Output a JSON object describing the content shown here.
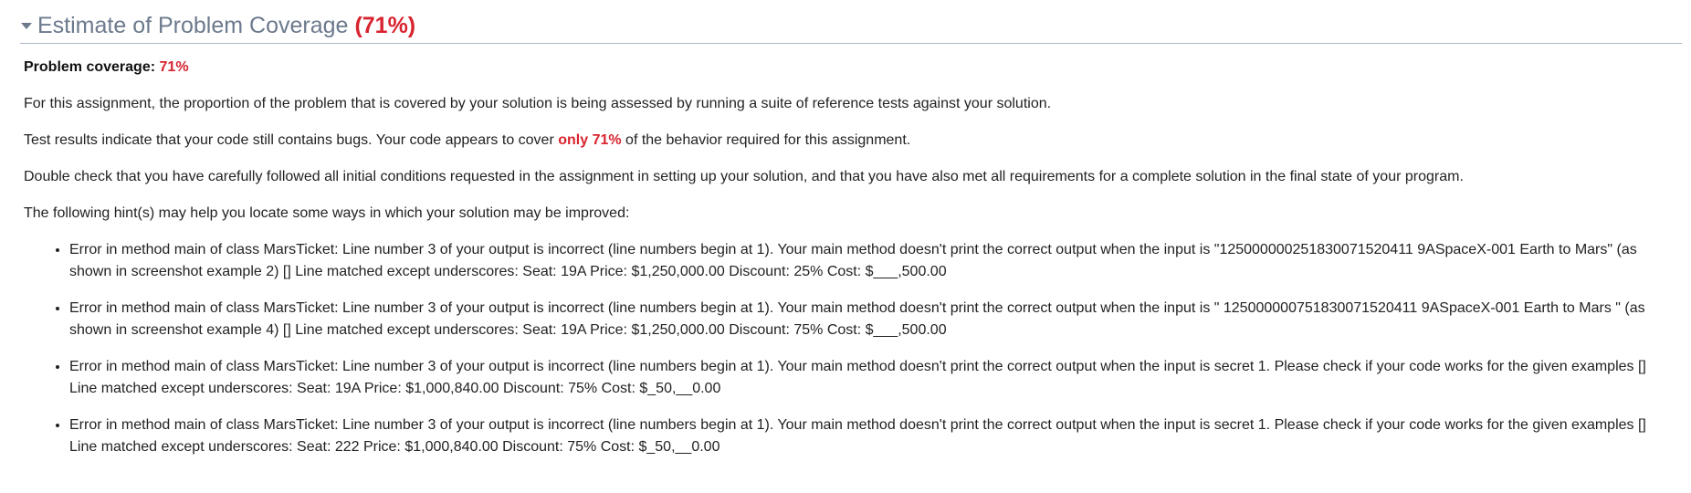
{
  "header": {
    "title": "Estimate of Problem Coverage",
    "percent": "(71%)",
    "caret_icon": "caret-down-icon"
  },
  "coverage": {
    "label": "Problem coverage:",
    "value": "71%"
  },
  "paragraphs": {
    "intro": "For this assignment, the proportion of the problem that is covered by your solution is being assessed by running a suite of reference tests against your solution.",
    "results_pre": "Test results indicate that your code still contains bugs. Your code appears to cover ",
    "results_highlight": "only 71%",
    "results_post": " of the behavior required for this assignment.",
    "double_check": "Double check that you have carefully followed all initial conditions requested in the assignment in setting up your solution, and that you have also met all requirements for a complete solution in the final state of your program.",
    "hints_intro": "The following hint(s) may help you locate some ways in which your solution may be improved:"
  },
  "hints": [
    "Error in method main of class MarsTicket: Line number 3 of your output is incorrect (line numbers begin at 1). Your main method doesn't print the correct output when the input is \"125000000251830071520411 9ASpaceX-001 Earth to Mars\" (as shown in screenshot example 2) [] Line matched except underscores: Seat: 19A Price: $1,250,000.00 Discount: 25% Cost: $___,500.00",
    "Error in method main of class MarsTicket: Line number 3 of your output is incorrect (line numbers begin at 1). Your main method doesn't print the correct output when the input is \" 125000000751830071520411 9ASpaceX-001 Earth to Mars \" (as shown in screenshot example 4) [] Line matched except underscores: Seat: 19A Price: $1,250,000.00 Discount: 75% Cost: $___,500.00",
    "Error in method main of class MarsTicket: Line number 3 of your output is incorrect (line numbers begin at 1). Your main method doesn't print the correct output when the input is secret 1. Please check if your code works for the given examples [] Line matched except underscores: Seat: 19A Price: $1,000,840.00 Discount: 75% Cost: $_50,__0.00",
    "Error in method main of class MarsTicket: Line number 3 of your output is incorrect (line numbers begin at 1). Your main method doesn't print the correct output when the input is secret 1. Please check if your code works for the given examples [] Line matched except underscores: Seat: 222 Price: $1,000,840.00 Discount: 75% Cost: $_50,__0.00"
  ],
  "colors": {
    "header_text": "#6c7a8d",
    "accent_red": "#d8242f",
    "divider": "#a8b6c6"
  }
}
